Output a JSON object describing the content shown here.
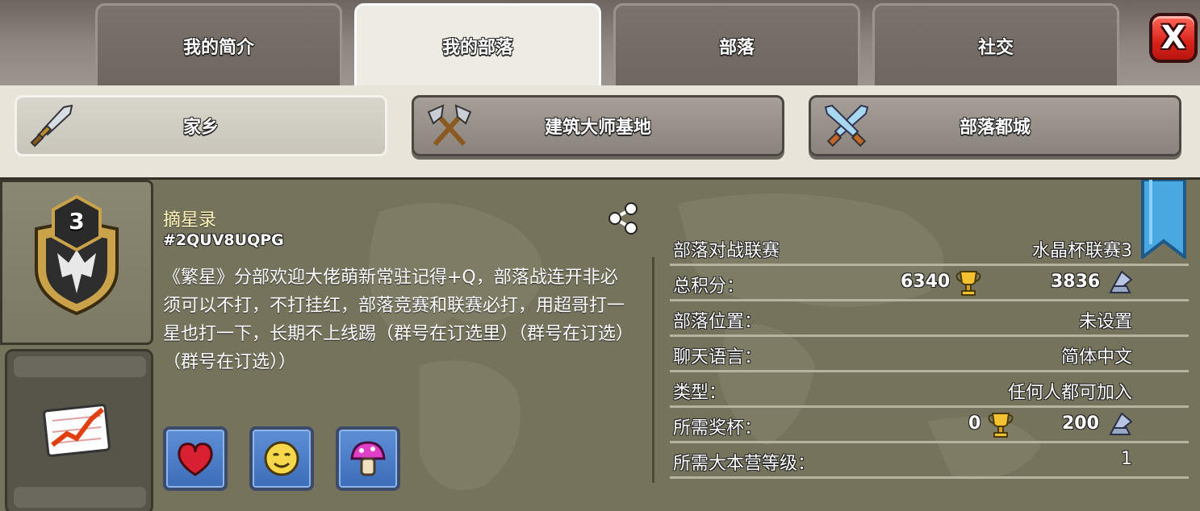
{
  "tabs": [
    {
      "label": "我的简介",
      "active": false
    },
    {
      "label": "我的部落",
      "active": true
    },
    {
      "label": "部落",
      "active": false
    },
    {
      "label": "社交",
      "active": false
    }
  ],
  "close_label": "X",
  "subnav": [
    {
      "label": "家乡",
      "icon": "sword-icon",
      "active": true
    },
    {
      "label": "建筑大师基地",
      "icon": "crossed-axes-icon",
      "active": false
    },
    {
      "label": "部落都城",
      "icon": "crossed-swords-icon",
      "active": false
    }
  ],
  "clan": {
    "level": "3",
    "name": "摘星录",
    "tag": "#2QUV8UQPG",
    "description": "《繁星》分部欢迎大佬萌新常驻记得+Q，部落战连开非必须可以不打，不打挂红，部落竞赛和联赛必打，用超哥打一星也打一下，长期不上线踢（群号在订选里）（群号在订选）（群号在订选））",
    "labels": [
      "heart-label-icon",
      "smiley-label-icon",
      "mushroom-label-icon"
    ]
  },
  "info": {
    "war_league_label": "部落对战联赛",
    "war_league_value": "水晶杯联赛3",
    "total_points_label": "总积分：",
    "total_trophies": "6340",
    "total_builder_trophies": "3836",
    "location_label": "部落位置：",
    "location_value": "未设置",
    "chat_language_label": "聊天语言：",
    "chat_language_value": "简体中文",
    "type_label": "类型：",
    "type_value": "任何人都可加入",
    "required_trophies_label": "所需奖杯：",
    "required_trophies": "0",
    "required_builder_trophies": "200",
    "required_th_label": "所需大本营等级：",
    "required_th_value": "1"
  },
  "colors": {
    "active_tab": "#eeebe3",
    "panel": "#76735d",
    "close_red": "#d8231a",
    "clan_name": "#fff6b8"
  }
}
